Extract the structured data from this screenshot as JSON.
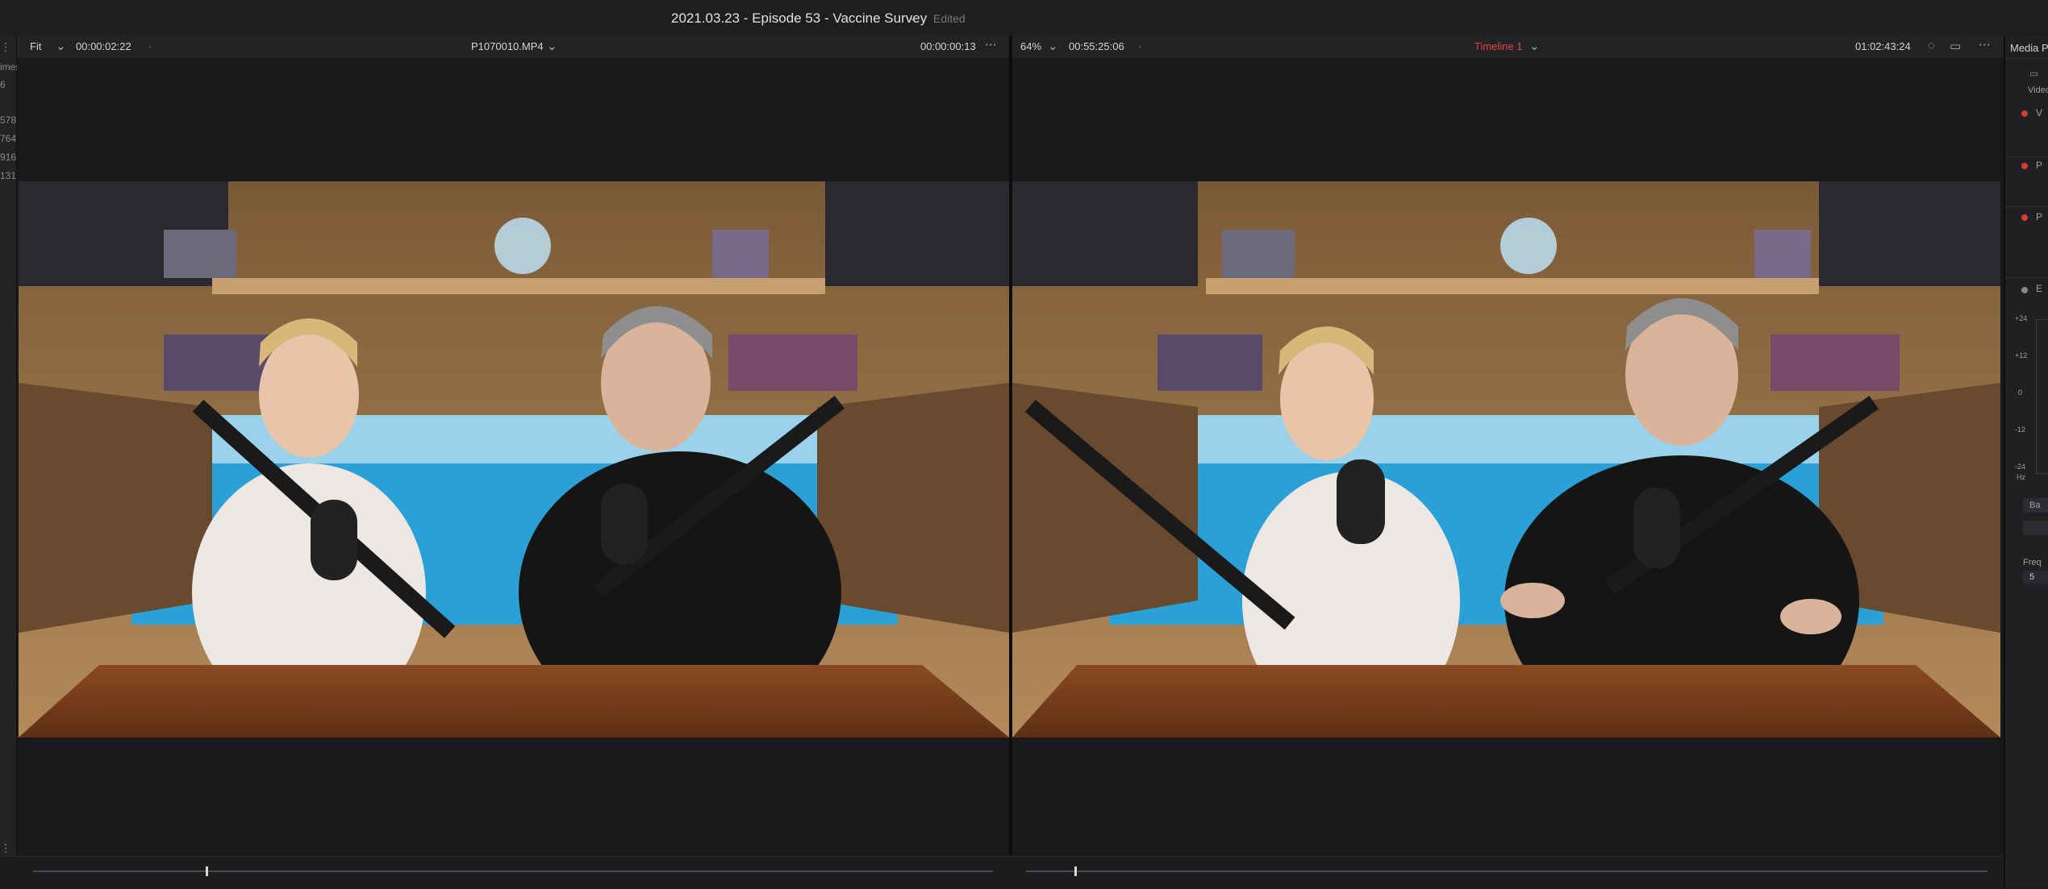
{
  "titlebar": {
    "project_title": "2021.03.23 - Episode 53 - Vaccine Survey",
    "status": "Edited"
  },
  "left_strip": {
    "items": [
      "imes",
      "6",
      "578",
      "764",
      "916",
      "131"
    ]
  },
  "source_viewer": {
    "zoom": "Fit",
    "timecode_left": "00:00:02:22",
    "clip_name": "P1070010.MP4",
    "timecode_right": "00:00:00:13",
    "playhead_fraction": 0.18
  },
  "timeline_viewer": {
    "zoom": "64%",
    "timecode_left": "00:55:25:06",
    "timeline_name": "Timeline 1",
    "timecode_right": "01:02:43:24",
    "playhead_fraction": 0.05
  },
  "right_panel": {
    "title": "Media P",
    "subtitle": "Video",
    "tracks": [
      "V",
      "P",
      "P"
    ],
    "eq_label": "E",
    "db_ticks": [
      "+24",
      "+12",
      "0",
      "-12",
      "-24"
    ],
    "hz_label": "Hz",
    "band_label": "Ba",
    "freq_label": "Freq",
    "freq_value": "5"
  },
  "colors": {
    "accent_red": "#e0463c",
    "background": "#1c1c1e"
  }
}
